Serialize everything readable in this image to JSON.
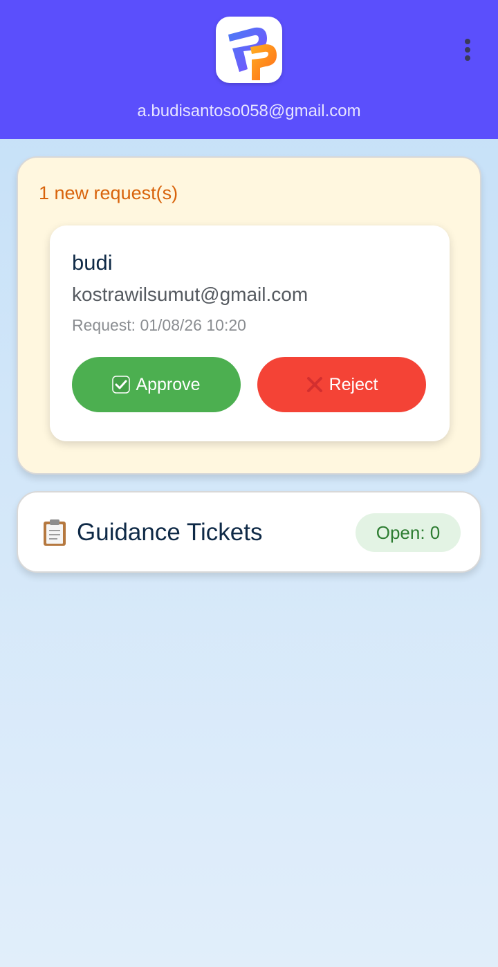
{
  "header": {
    "email": "a.budisantoso058@gmail.com",
    "logo_icon": "app-logo",
    "menu_icon": "more-vertical-icon",
    "background_color": "#5b4ffc"
  },
  "requests": {
    "count_text": "1 new request(s)",
    "items": [
      {
        "name": "budi",
        "email": "kostrawilsumut@gmail.com",
        "request_time": "Request: 01/08/26 10:20",
        "approve_label": "Approve",
        "reject_label": "Reject"
      }
    ]
  },
  "tickets": {
    "title": "Guidance Tickets",
    "open_badge": "Open: 0",
    "icon": "clipboard-icon"
  },
  "colors": {
    "approve": "#4caf50",
    "reject": "#f44336",
    "request_count": "#d8630b",
    "badge_text": "#2e7d32"
  }
}
